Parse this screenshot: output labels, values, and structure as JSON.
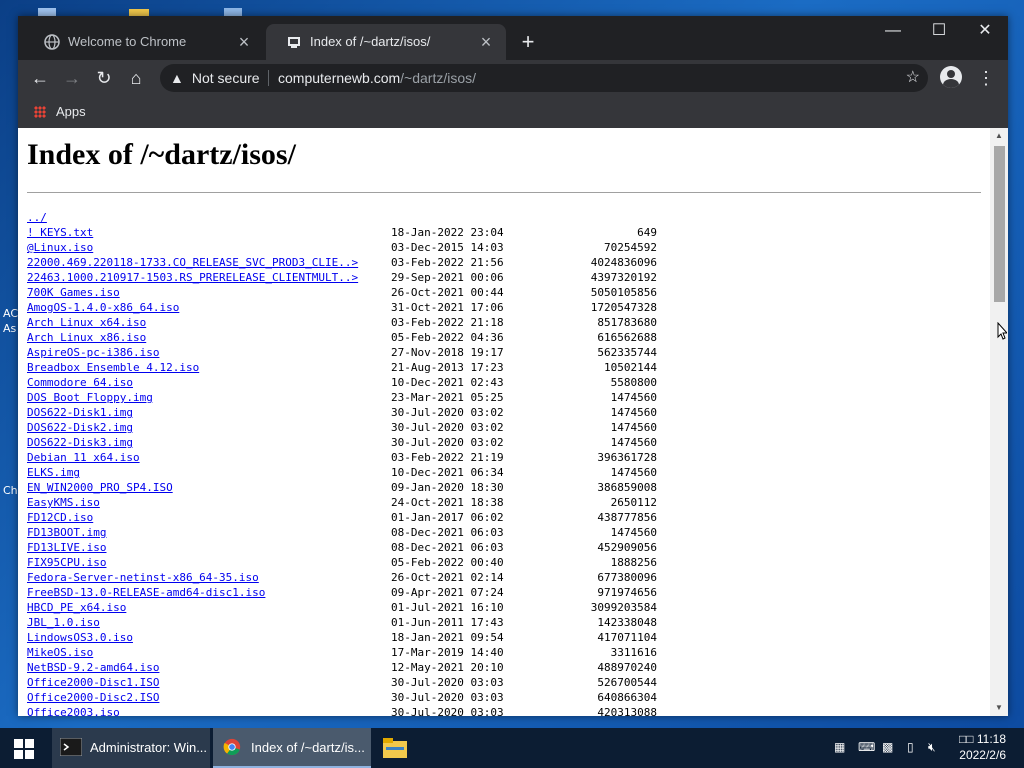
{
  "browser": {
    "tabs": [
      {
        "title": "Welcome to Chrome",
        "active": false
      },
      {
        "title": "Index of /~dartz/isos/",
        "active": true
      }
    ],
    "new_tab": "+",
    "window_controls": {
      "minimize": "—",
      "maximize": "☐",
      "close": "✕"
    },
    "toolbar": {
      "back": "←",
      "forward": "→",
      "reload": "↻",
      "home": "⌂",
      "menu": "⋮"
    },
    "omnibox": {
      "security_label": "Not secure",
      "security_icon": "warning-triangle-icon",
      "host": "computernewb.com",
      "path": "/~dartz/isos/",
      "bookmark_icon": "☆"
    },
    "bookmarks_bar": {
      "apps_label": "Apps"
    }
  },
  "page": {
    "heading": "Index of /~dartz/isos/",
    "entries": [
      {
        "name": "../",
        "date": "",
        "size": ""
      },
      {
        "name": "! KEYS.txt",
        "date": "18-Jan-2022 23:04",
        "size": "649"
      },
      {
        "name": "@Linux.iso",
        "date": "03-Dec-2015 14:03",
        "size": "70254592"
      },
      {
        "name": "22000.469.220118-1733.CO_RELEASE_SVC_PROD3_CLIE..>",
        "date": "03-Feb-2022 21:56",
        "size": "4024836096"
      },
      {
        "name": "22463.1000.210917-1503.RS_PRERELEASE_CLIENTMULT..>",
        "date": "29-Sep-2021 00:06",
        "size": "4397320192"
      },
      {
        "name": "700K Games.iso",
        "date": "26-Oct-2021 00:44",
        "size": "5050105856"
      },
      {
        "name": "AmogOS-1.4.0-x86_64.iso",
        "date": "31-Oct-2021 17:06",
        "size": "1720547328"
      },
      {
        "name": "Arch Linux x64.iso",
        "date": "03-Feb-2022 21:18",
        "size": "851783680"
      },
      {
        "name": "Arch Linux x86.iso",
        "date": "05-Feb-2022 04:36",
        "size": "616562688"
      },
      {
        "name": "AspireOS-pc-i386.iso",
        "date": "27-Nov-2018 19:17",
        "size": "562335744"
      },
      {
        "name": "Breadbox Ensemble 4.12.iso",
        "date": "21-Aug-2013 17:23",
        "size": "10502144"
      },
      {
        "name": "Commodore 64.iso",
        "date": "10-Dec-2021 02:43",
        "size": "5580800"
      },
      {
        "name": "DOS Boot Floppy.img",
        "date": "23-Mar-2021 05:25",
        "size": "1474560"
      },
      {
        "name": "DOS622-Disk1.img",
        "date": "30-Jul-2020 03:02",
        "size": "1474560"
      },
      {
        "name": "DOS622-Disk2.img",
        "date": "30-Jul-2020 03:02",
        "size": "1474560"
      },
      {
        "name": "DOS622-Disk3.img",
        "date": "30-Jul-2020 03:02",
        "size": "1474560"
      },
      {
        "name": "Debian 11 x64.iso",
        "date": "03-Feb-2022 21:19",
        "size": "396361728"
      },
      {
        "name": "ELKS.img",
        "date": "10-Dec-2021 06:34",
        "size": "1474560"
      },
      {
        "name": "EN_WIN2000_PRO_SP4.ISO",
        "date": "09-Jan-2020 18:30",
        "size": "386859008"
      },
      {
        "name": "EasyKMS.iso",
        "date": "24-Oct-2021 18:38",
        "size": "2650112"
      },
      {
        "name": "FD12CD.iso",
        "date": "01-Jan-2017 06:02",
        "size": "438777856"
      },
      {
        "name": "FD13BOOT.img",
        "date": "08-Dec-2021 06:03",
        "size": "1474560"
      },
      {
        "name": "FD13LIVE.iso",
        "date": "08-Dec-2021 06:03",
        "size": "452909056"
      },
      {
        "name": "FIX95CPU.iso",
        "date": "05-Feb-2022 00:40",
        "size": "1888256"
      },
      {
        "name": "Fedora-Server-netinst-x86_64-35.iso",
        "date": "26-Oct-2021 02:14",
        "size": "677380096"
      },
      {
        "name": "FreeBSD-13.0-RELEASE-amd64-disc1.iso",
        "date": "09-Apr-2021 07:24",
        "size": "971974656"
      },
      {
        "name": "HBCD_PE_x64.iso",
        "date": "01-Jul-2021 16:10",
        "size": "3099203584"
      },
      {
        "name": "JBL_1.0.iso",
        "date": "01-Jun-2011 17:43",
        "size": "142338048"
      },
      {
        "name": "LindowsOS3.0.iso",
        "date": "18-Jan-2021 09:54",
        "size": "417071104"
      },
      {
        "name": "MikeOS.iso",
        "date": "17-Mar-2019 14:40",
        "size": "3311616"
      },
      {
        "name": "NetBSD-9.2-amd64.iso",
        "date": "12-May-2021 20:10",
        "size": "488970240"
      },
      {
        "name": "Office2000-Disc1.ISO",
        "date": "30-Jul-2020 03:03",
        "size": "526700544"
      },
      {
        "name": "Office2000-Disc2.ISO",
        "date": "30-Jul-2020 03:03",
        "size": "640866304"
      },
      {
        "name": "Office2003.iso",
        "date": "30-Jul-2020 03:03",
        "size": "420313088"
      }
    ]
  },
  "desktop": {
    "fragments": [
      "AC",
      "As",
      "Ch"
    ]
  },
  "taskbar": {
    "items": [
      {
        "label": "Administrator: Win..."
      },
      {
        "label": "Index of /~dartz/is..."
      }
    ],
    "clock_time": "□□ 11:18",
    "clock_date": "2022/2/6"
  },
  "colors": {
    "link": "#0000ee",
    "chrome_dark": "#202124",
    "chrome_toolbar": "#35363a",
    "taskbar": "#0c1d33"
  }
}
